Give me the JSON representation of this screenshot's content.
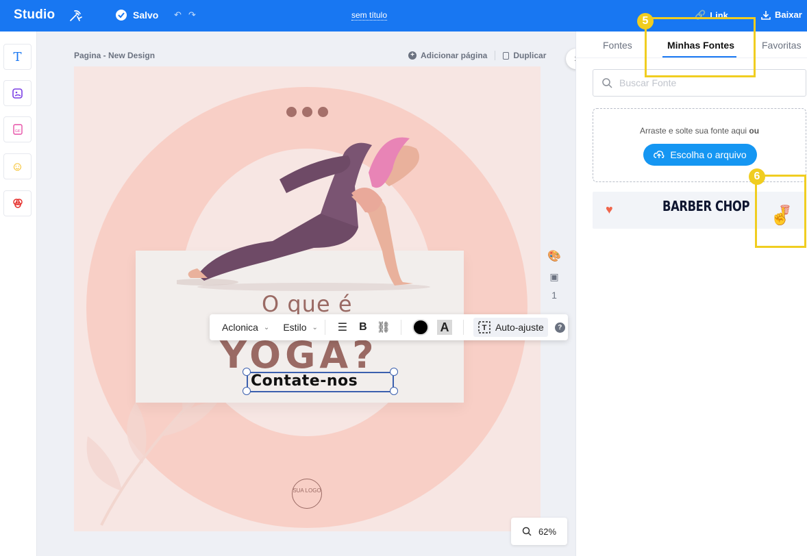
{
  "topbar": {
    "brand": "Studio",
    "saved_label": "Salvo",
    "doc_title": "sem título",
    "link_label": "Link",
    "download_label": "Baixar"
  },
  "rail": {
    "items": [
      "text-tool",
      "image-tool",
      "gif-tool",
      "emoji-tool",
      "shapes-tool"
    ]
  },
  "canvas": {
    "page_label": "Pagina - New Design",
    "add_page": "Adicionar página",
    "duplicate": "Duplicar",
    "headline": "O que é",
    "title": "YOGA?",
    "contact": "Contate-nos",
    "logo": "SUA LOGO",
    "side_page_number": "1",
    "zoom": "62%"
  },
  "toolbar": {
    "font": "Aclonica",
    "style": "Estilo",
    "bold": "B",
    "bg_letter": "A",
    "auto_fit": "Auto-ajuste",
    "help": "?"
  },
  "panel": {
    "tabs": [
      "Fontes",
      "Minhas Fontes",
      "Favoritas"
    ],
    "active_tab": "Minhas Fontes",
    "search_placeholder": "Buscar Fonte",
    "drop_text": "Arraste e solte sua fonte aqui",
    "drop_or": "ou",
    "upload_button": "Escolha o arquivo",
    "fonts": [
      {
        "name": "BARBER CHOP",
        "favorite": true
      }
    ]
  },
  "annotations": {
    "step5": "5",
    "step6": "6"
  },
  "colors": {
    "accent": "#1877f2",
    "callout": "#f0cd20",
    "canvas_bg": "#f7e6e3",
    "ring": "#f8cfc6",
    "title_color": "#9a6a64"
  }
}
